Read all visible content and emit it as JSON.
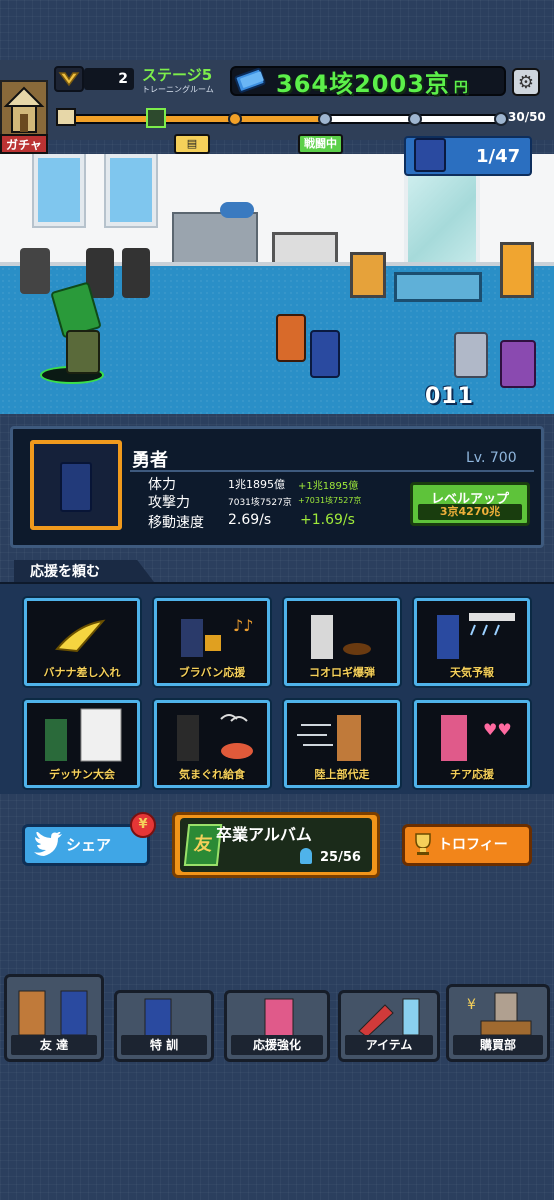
{
  "hud": {
    "medal_count": "2",
    "stage": "ステージ5",
    "stage_sub": "トレーニングルーム",
    "money": "364垓2003京",
    "money_unit": "円",
    "progress": "30/50",
    "progress_value": 30,
    "progress_max": 50,
    "gacha_label": "ガチャ",
    "node_label_fighting": "戦闘中"
  },
  "scene": {
    "battle_count": "1/47",
    "damage_text": "011"
  },
  "hero": {
    "name": "勇者",
    "level": "Lv. 700",
    "stats": [
      {
        "label": "体力",
        "value": "1兆1895億",
        "inc": "+1兆1895億"
      },
      {
        "label": "攻撃力",
        "value": "7031垓7527京",
        "inc": "+7031垓7527京"
      },
      {
        "label": "移動速度",
        "value": "2.69/s",
        "inc": "+1.69/s"
      }
    ],
    "levelup_label": "レベルアップ",
    "levelup_cost": "3京4270兆"
  },
  "support": {
    "header": "応援を頼む",
    "cards": [
      {
        "label": "バナナ差し入れ",
        "icon": "banana-icon"
      },
      {
        "label": "ブラバン応援",
        "icon": "brass-band-icon"
      },
      {
        "label": "コオロギ爆弾",
        "icon": "cricket-bomb-icon"
      },
      {
        "label": "天気予報",
        "icon": "weather-icon"
      },
      {
        "label": "デッサン大会",
        "icon": "sketch-icon"
      },
      {
        "label": "気まぐれ給食",
        "icon": "lunch-icon"
      },
      {
        "label": "陸上部代走",
        "icon": "runner-icon"
      },
      {
        "label": "チア応援",
        "icon": "cheer-icon"
      }
    ]
  },
  "actions": {
    "share": "シェア",
    "share_badge": "¥",
    "album_title": "卒業アルバム",
    "album_icon": "友",
    "album_count": "25/56",
    "trophy": "トロフィー"
  },
  "nav": [
    {
      "label": "友 達"
    },
    {
      "label": "特 訓"
    },
    {
      "label": "応援強化"
    },
    {
      "label": "アイテム"
    },
    {
      "label": "購買部"
    }
  ],
  "colors": {
    "accent_green": "#5cf04a",
    "accent_orange": "#f2951a",
    "card_border": "#4fb3ea"
  }
}
